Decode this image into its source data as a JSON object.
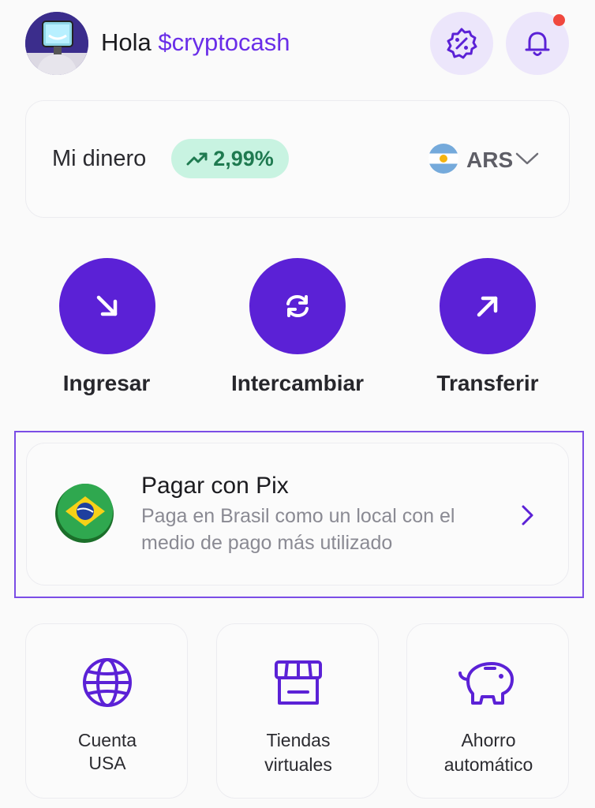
{
  "header": {
    "greeting_prefix": "Hola",
    "username": "$cryptocash",
    "avatar_icon": "user-avatar",
    "promo_icon": "discount-badge-icon",
    "notification_icon": "bell-icon",
    "has_notification": true
  },
  "balance": {
    "label": "Mi dinero",
    "change": "2,99%",
    "change_icon": "trending-up-icon",
    "currency": "ARS",
    "currency_flag": "argentina-flag"
  },
  "actions": [
    {
      "label": "Ingresar",
      "icon": "arrow-down-right-icon"
    },
    {
      "label": "Intercambiar",
      "icon": "refresh-icon"
    },
    {
      "label": "Transferir",
      "icon": "arrow-up-right-icon"
    }
  ],
  "pix": {
    "title": "Pagar con Pix",
    "description": "Paga en Brasil como un local con el medio de pago más utilizado",
    "icon": "brazil-flag-coin"
  },
  "shortcuts": [
    {
      "label_line1": "Cuenta",
      "label_line2": "USA",
      "icon": "globe-icon"
    },
    {
      "label_line1": "Tiendas",
      "label_line2": "virtuales",
      "icon": "store-icon"
    },
    {
      "label_line1": "Ahorro",
      "label_line2": "automático",
      "icon": "piggy-bank-icon"
    }
  ],
  "colors": {
    "accent": "#5b21d6",
    "accent_light": "#ece6fb",
    "positive": "#1f7a50",
    "positive_bg": "#c8f3e1",
    "notification": "#f0483e"
  }
}
